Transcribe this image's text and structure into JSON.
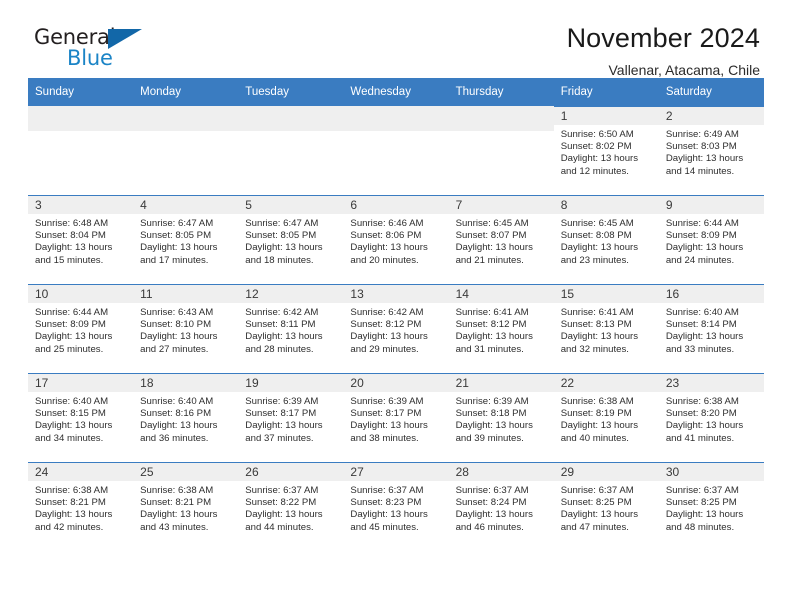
{
  "brand": {
    "name_part1": "General",
    "name_part2": "Blue"
  },
  "header": {
    "title": "November 2024",
    "subtitle": "Vallenar, Atacama, Chile"
  },
  "colors": {
    "header_blue": "#3a7cc1",
    "brand_blue": "#1b84c6",
    "daynum_bg": "#efefef"
  },
  "weekday_headers": [
    "Sunday",
    "Monday",
    "Tuesday",
    "Wednesday",
    "Thursday",
    "Friday",
    "Saturday"
  ],
  "weeks": [
    [
      {
        "empty": true
      },
      {
        "empty": true
      },
      {
        "empty": true
      },
      {
        "empty": true
      },
      {
        "empty": true
      },
      {
        "day": "1",
        "sunrise": "Sunrise: 6:50 AM",
        "sunset": "Sunset: 8:02 PM",
        "daylight": "Daylight: 13 hours and 12 minutes."
      },
      {
        "day": "2",
        "sunrise": "Sunrise: 6:49 AM",
        "sunset": "Sunset: 8:03 PM",
        "daylight": "Daylight: 13 hours and 14 minutes."
      }
    ],
    [
      {
        "day": "3",
        "sunrise": "Sunrise: 6:48 AM",
        "sunset": "Sunset: 8:04 PM",
        "daylight": "Daylight: 13 hours and 15 minutes."
      },
      {
        "day": "4",
        "sunrise": "Sunrise: 6:47 AM",
        "sunset": "Sunset: 8:05 PM",
        "daylight": "Daylight: 13 hours and 17 minutes."
      },
      {
        "day": "5",
        "sunrise": "Sunrise: 6:47 AM",
        "sunset": "Sunset: 8:05 PM",
        "daylight": "Daylight: 13 hours and 18 minutes."
      },
      {
        "day": "6",
        "sunrise": "Sunrise: 6:46 AM",
        "sunset": "Sunset: 8:06 PM",
        "daylight": "Daylight: 13 hours and 20 minutes."
      },
      {
        "day": "7",
        "sunrise": "Sunrise: 6:45 AM",
        "sunset": "Sunset: 8:07 PM",
        "daylight": "Daylight: 13 hours and 21 minutes."
      },
      {
        "day": "8",
        "sunrise": "Sunrise: 6:45 AM",
        "sunset": "Sunset: 8:08 PM",
        "daylight": "Daylight: 13 hours and 23 minutes."
      },
      {
        "day": "9",
        "sunrise": "Sunrise: 6:44 AM",
        "sunset": "Sunset: 8:09 PM",
        "daylight": "Daylight: 13 hours and 24 minutes."
      }
    ],
    [
      {
        "day": "10",
        "sunrise": "Sunrise: 6:44 AM",
        "sunset": "Sunset: 8:09 PM",
        "daylight": "Daylight: 13 hours and 25 minutes."
      },
      {
        "day": "11",
        "sunrise": "Sunrise: 6:43 AM",
        "sunset": "Sunset: 8:10 PM",
        "daylight": "Daylight: 13 hours and 27 minutes."
      },
      {
        "day": "12",
        "sunrise": "Sunrise: 6:42 AM",
        "sunset": "Sunset: 8:11 PM",
        "daylight": "Daylight: 13 hours and 28 minutes."
      },
      {
        "day": "13",
        "sunrise": "Sunrise: 6:42 AM",
        "sunset": "Sunset: 8:12 PM",
        "daylight": "Daylight: 13 hours and 29 minutes."
      },
      {
        "day": "14",
        "sunrise": "Sunrise: 6:41 AM",
        "sunset": "Sunset: 8:12 PM",
        "daylight": "Daylight: 13 hours and 31 minutes."
      },
      {
        "day": "15",
        "sunrise": "Sunrise: 6:41 AM",
        "sunset": "Sunset: 8:13 PM",
        "daylight": "Daylight: 13 hours and 32 minutes."
      },
      {
        "day": "16",
        "sunrise": "Sunrise: 6:40 AM",
        "sunset": "Sunset: 8:14 PM",
        "daylight": "Daylight: 13 hours and 33 minutes."
      }
    ],
    [
      {
        "day": "17",
        "sunrise": "Sunrise: 6:40 AM",
        "sunset": "Sunset: 8:15 PM",
        "daylight": "Daylight: 13 hours and 34 minutes."
      },
      {
        "day": "18",
        "sunrise": "Sunrise: 6:40 AM",
        "sunset": "Sunset: 8:16 PM",
        "daylight": "Daylight: 13 hours and 36 minutes."
      },
      {
        "day": "19",
        "sunrise": "Sunrise: 6:39 AM",
        "sunset": "Sunset: 8:17 PM",
        "daylight": "Daylight: 13 hours and 37 minutes."
      },
      {
        "day": "20",
        "sunrise": "Sunrise: 6:39 AM",
        "sunset": "Sunset: 8:17 PM",
        "daylight": "Daylight: 13 hours and 38 minutes."
      },
      {
        "day": "21",
        "sunrise": "Sunrise: 6:39 AM",
        "sunset": "Sunset: 8:18 PM",
        "daylight": "Daylight: 13 hours and 39 minutes."
      },
      {
        "day": "22",
        "sunrise": "Sunrise: 6:38 AM",
        "sunset": "Sunset: 8:19 PM",
        "daylight": "Daylight: 13 hours and 40 minutes."
      },
      {
        "day": "23",
        "sunrise": "Sunrise: 6:38 AM",
        "sunset": "Sunset: 8:20 PM",
        "daylight": "Daylight: 13 hours and 41 minutes."
      }
    ],
    [
      {
        "day": "24",
        "sunrise": "Sunrise: 6:38 AM",
        "sunset": "Sunset: 8:21 PM",
        "daylight": "Daylight: 13 hours and 42 minutes."
      },
      {
        "day": "25",
        "sunrise": "Sunrise: 6:38 AM",
        "sunset": "Sunset: 8:21 PM",
        "daylight": "Daylight: 13 hours and 43 minutes."
      },
      {
        "day": "26",
        "sunrise": "Sunrise: 6:37 AM",
        "sunset": "Sunset: 8:22 PM",
        "daylight": "Daylight: 13 hours and 44 minutes."
      },
      {
        "day": "27",
        "sunrise": "Sunrise: 6:37 AM",
        "sunset": "Sunset: 8:23 PM",
        "daylight": "Daylight: 13 hours and 45 minutes."
      },
      {
        "day": "28",
        "sunrise": "Sunrise: 6:37 AM",
        "sunset": "Sunset: 8:24 PM",
        "daylight": "Daylight: 13 hours and 46 minutes."
      },
      {
        "day": "29",
        "sunrise": "Sunrise: 6:37 AM",
        "sunset": "Sunset: 8:25 PM",
        "daylight": "Daylight: 13 hours and 47 minutes."
      },
      {
        "day": "30",
        "sunrise": "Sunrise: 6:37 AM",
        "sunset": "Sunset: 8:25 PM",
        "daylight": "Daylight: 13 hours and 48 minutes."
      }
    ]
  ]
}
